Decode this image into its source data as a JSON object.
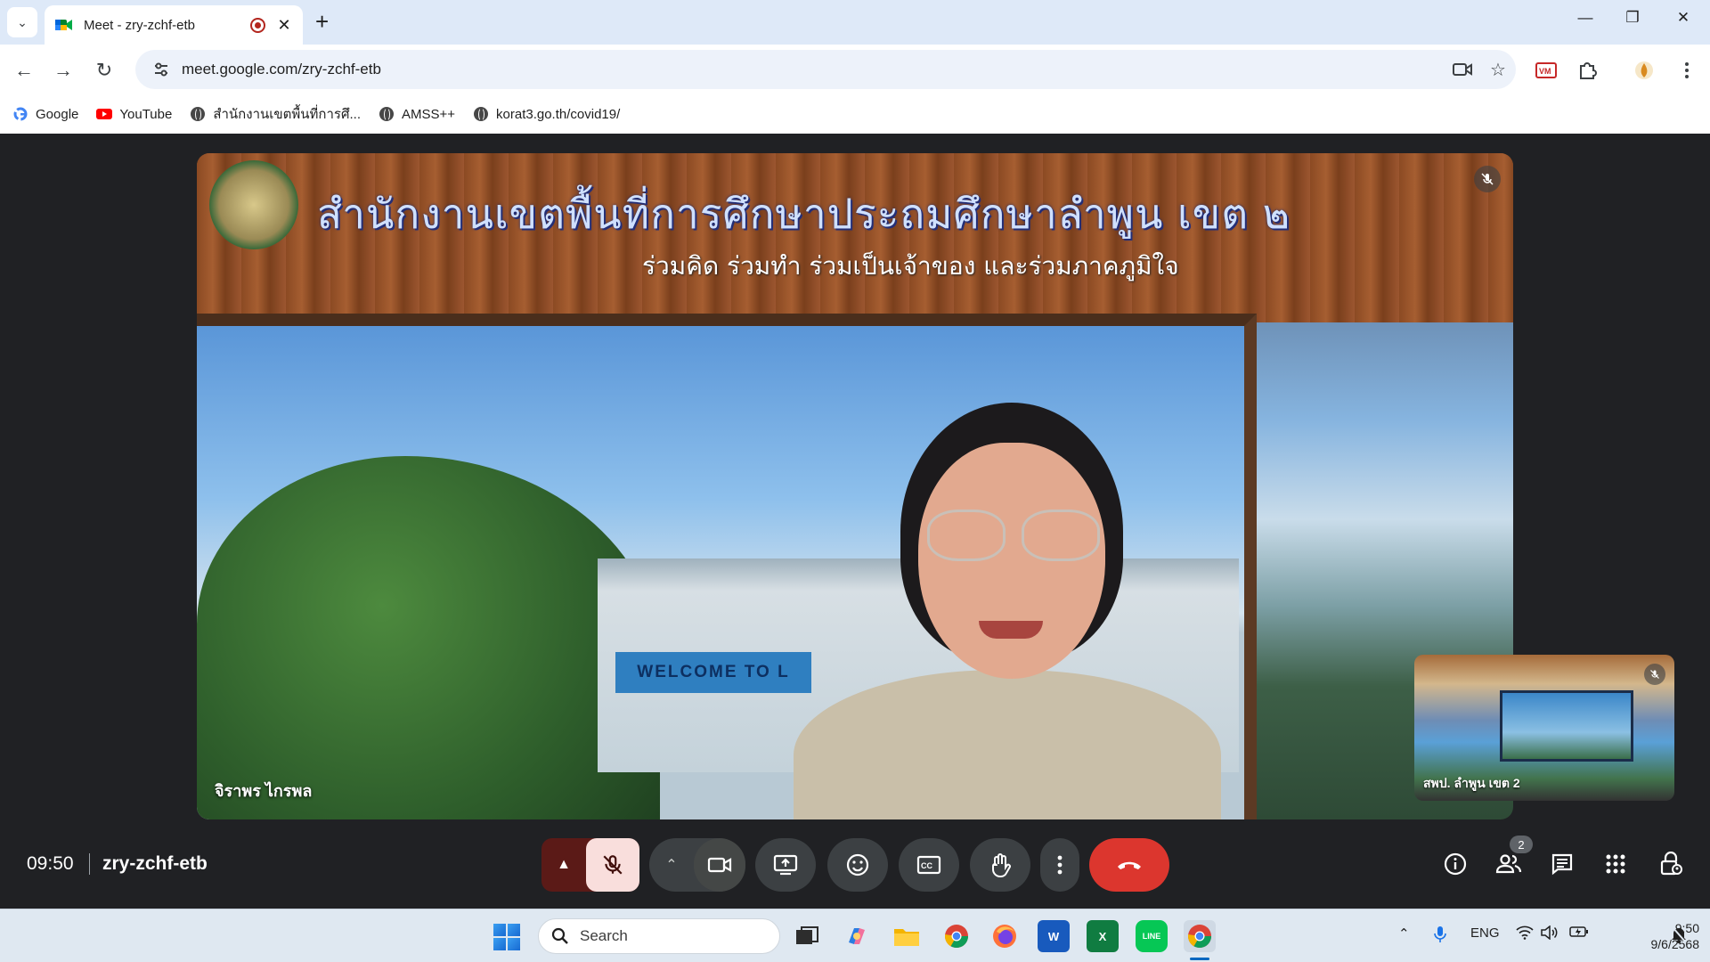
{
  "browser": {
    "tab_title": "Meet - zry-zchf-etb",
    "url": "meet.google.com/zry-zchf-etb",
    "bookmarks": [
      {
        "label": "Google",
        "icon": "google-icon"
      },
      {
        "label": "YouTube",
        "icon": "youtube-icon"
      },
      {
        "label": "สำนักงานเขตพื้นที่การศึ...",
        "icon": "globe-icon"
      },
      {
        "label": "AMSS++",
        "icon": "globe-icon"
      },
      {
        "label": "korat3.go.th/covid19/",
        "icon": "globe-icon"
      }
    ]
  },
  "meeting": {
    "main_tile": {
      "banner_title": "สำนักงานเขตพื้นที่การศึกษาประถมศึกษาลำพูน เขต ๒",
      "banner_subtitle": "ร่วมคิด ร่วมทำ ร่วมเป็นเจ้าของ และร่วมภาคภูมิใจ",
      "welcome_sign": "WELCOME TO L",
      "participant_name": "จิราพร ไกรพล",
      "muted": true
    },
    "self_tile": {
      "participant_name": "สพป. ลำพูน เขต 2",
      "muted": true
    },
    "time": "09:50",
    "code": "zry-zchf-etb",
    "people_count": "2"
  },
  "taskbar": {
    "search_placeholder": "Search",
    "language": "ENG",
    "time": "9:50",
    "date": "9/6/2568"
  },
  "colors": {
    "meet_bg": "#202124",
    "end_call": "#dc362e",
    "mic_off_bg": "#f9dedc",
    "tabbar": "#dee9f8"
  }
}
